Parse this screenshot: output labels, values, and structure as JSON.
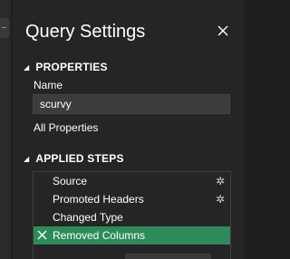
{
  "panel": {
    "title": "Query Settings",
    "close_icon": "close-icon"
  },
  "properties": {
    "header": "PROPERTIES",
    "name_label": "Name",
    "name_value": "scurvy",
    "all_properties_link": "All Properties"
  },
  "applied_steps": {
    "header": "APPLIED STEPS",
    "steps": [
      {
        "label": "Source",
        "icon": "gear-icon"
      },
      {
        "label": "Promoted Headers",
        "icon": "gear-icon"
      },
      {
        "label": "Changed Type"
      },
      {
        "label": "Removed Columns",
        "selected": true,
        "icon": "delete-step-icon"
      }
    ]
  },
  "colors": {
    "background": "#252526",
    "selected_step": "#2d8b5a",
    "input_background": "#3c3c3c"
  }
}
